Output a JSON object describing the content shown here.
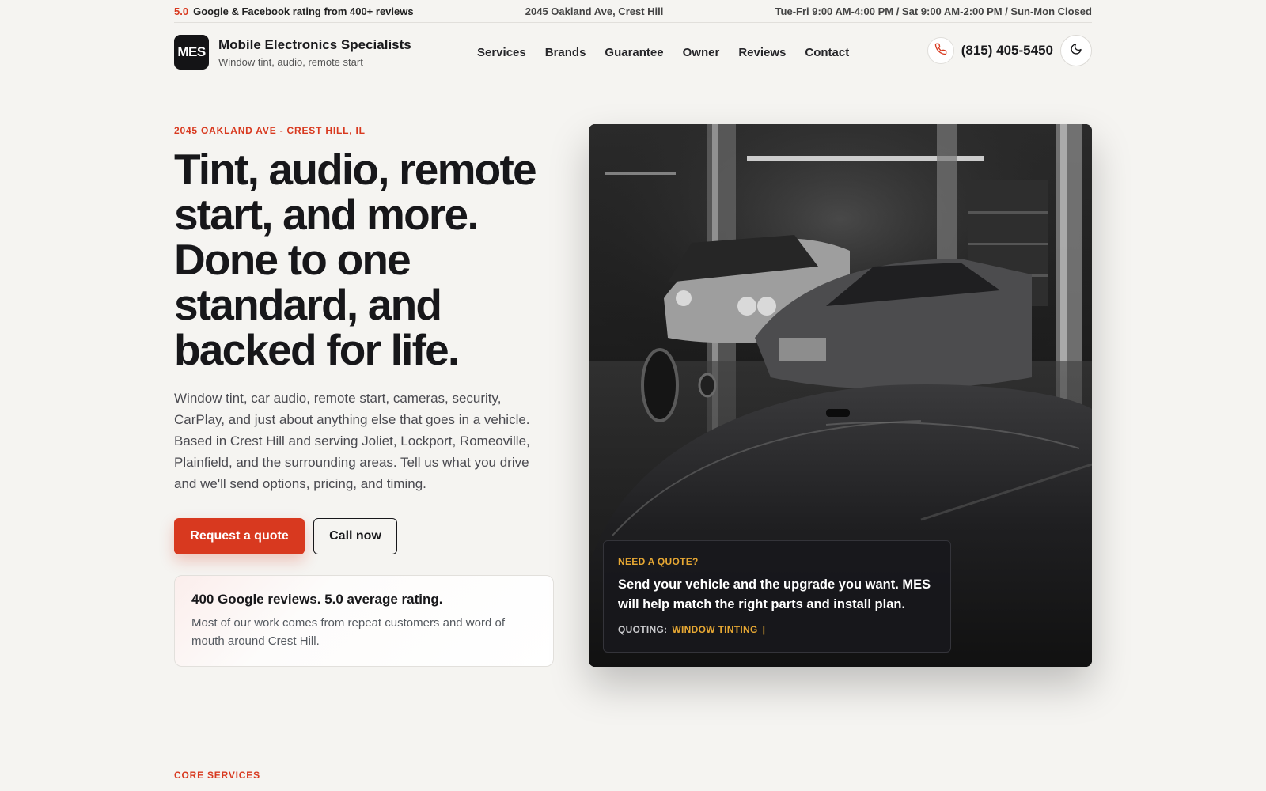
{
  "topbar": {
    "rating_value": "5.0",
    "rating_text": "Google & Facebook rating from 400+ reviews",
    "address": "2045 Oakland Ave, Crest Hill",
    "hours": "Tue-Fri 9:00 AM-4:00 PM / Sat 9:00 AM-2:00 PM / Sun-Mon Closed"
  },
  "brand": {
    "logo_text": "MES",
    "name": "Mobile Electronics Specialists",
    "tagline": "Window tint, audio, remote start"
  },
  "nav": {
    "items": [
      {
        "label": "Services"
      },
      {
        "label": "Brands"
      },
      {
        "label": "Guarantee"
      },
      {
        "label": "Owner"
      },
      {
        "label": "Reviews"
      },
      {
        "label": "Contact"
      }
    ]
  },
  "header_right": {
    "phone_icon": "phone-icon",
    "phone": "(815) 405-5450",
    "theme_icon": "moon-icon"
  },
  "hero": {
    "eyebrow": "2045 OAKLAND AVE - CREST HILL, IL",
    "title": "Tint, audio, remote start, and more. Done to one standard, and backed for life.",
    "description": "Window tint, car audio, remote start, cameras, security, CarPlay, and just about anything else that goes in a vehicle. Based in Crest Hill and serving Joliet, Lockport, Romeoville, Plainfield, and the surrounding areas. Tell us what you drive and we'll send options, pricing, and timing.",
    "primary_button": "Request a quote",
    "secondary_button": "Call now",
    "review_title": "400 Google reviews. 5.0 average rating.",
    "review_body": "Most of our work comes from repeat customers and word of mouth around Crest Hill."
  },
  "quote_card": {
    "eyebrow": "NEED A QUOTE?",
    "text": "Send your vehicle and the upgrade you want. MES will help match the right parts and install plan.",
    "label": "QUOTING:",
    "value": "WINDOW TINTING",
    "cursor": "|"
  },
  "next_section": {
    "eyebrow": "CORE SERVICES"
  },
  "colors": {
    "accent": "#d8391f",
    "gold": "#e6a733",
    "background": "#f5f4f1",
    "dark": "#17171a"
  }
}
